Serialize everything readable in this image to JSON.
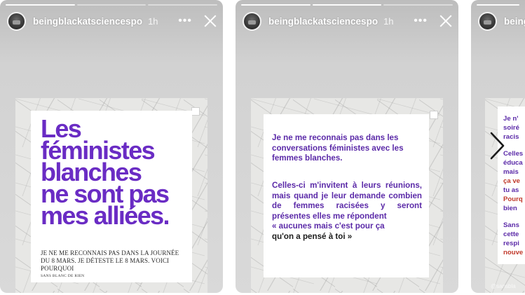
{
  "stories": [
    {
      "username": "beingblackatsciencespo",
      "time": "1h",
      "more_label": "•••",
      "headline": [
        "Les",
        "féministes",
        "blanches",
        "ne sont pas",
        "mes alliées."
      ],
      "subtext": "JE NE ME RECONNAIS PAS DANS LA JOURNÉE DU 8 MARS. JE DÉTESTE LE 8 MARS. VOICI POURQUOI",
      "signature": "SANS BLANC DE RIEN"
    },
    {
      "username": "beingblackatsciencespo",
      "time": "1h",
      "more_label": "•••",
      "para1": "Je ne me reconnais pas dans les conversations féministes avec les femmes blanches.",
      "para2": "Celles-ci m'invitent à leurs réunions, mais quand je leur demande combien de femmes racisées y seront présentes elles me répondent",
      "quote_part1": "« aucunes mais c'est pour ça",
      "quote_part2": "qu'on a pensé à toi »"
    },
    {
      "username": "beingblackatsciencespo",
      "fragments": [
        {
          "text": "Je n'",
          "color": "purple"
        },
        {
          "text": "soiré",
          "color": "purple"
        },
        {
          "text": "racis",
          "color": "purple"
        },
        {
          "text": "Celles",
          "color": "purple"
        },
        {
          "text": "éduca",
          "color": "purple"
        },
        {
          "text": "mais",
          "color": "purple"
        },
        {
          "text": "ça ve",
          "color": "red"
        },
        {
          "text": "tu as",
          "color": "purple"
        },
        {
          "text": "Pourq",
          "color": "red"
        },
        {
          "text": "bien",
          "color": "purple"
        },
        {
          "text": "Sans",
          "color": "purple"
        },
        {
          "text": "cette",
          "color": "purple"
        },
        {
          "text": "respi",
          "color": "purple"
        },
        {
          "text": "nouve",
          "color": "red"
        }
      ],
      "watermark": "@sansbla"
    }
  ],
  "colors": {
    "accent_purple": "#6a2cc4",
    "accent_red": "#c0392b"
  },
  "icons": [
    "more-icon",
    "close-icon",
    "next-arrow-icon"
  ]
}
